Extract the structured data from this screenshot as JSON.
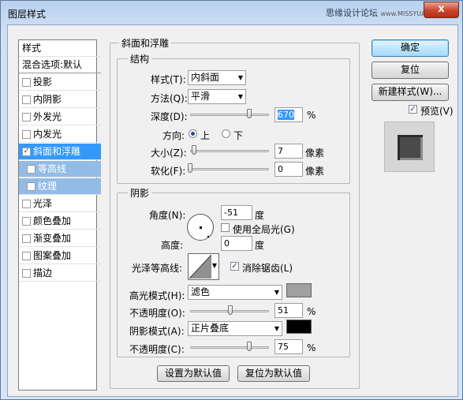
{
  "window": {
    "title": "图层样式",
    "watermark_main": "思缘设计论坛",
    "watermark_url": "www.MISSYUAN.com",
    "close_glyph": "x"
  },
  "styles_list": {
    "header": "样式",
    "blend_default": "混合选项:默认",
    "items": [
      {
        "label": "投影",
        "checked": false
      },
      {
        "label": "内阴影",
        "checked": false
      },
      {
        "label": "外发光",
        "checked": false
      },
      {
        "label": "内发光",
        "checked": false
      },
      {
        "label": "斜面和浮雕",
        "checked": true
      },
      {
        "label": "等高线",
        "checked": false
      },
      {
        "label": "纹理",
        "checked": false
      },
      {
        "label": "光泽",
        "checked": false
      },
      {
        "label": "颜色叠加",
        "checked": false
      },
      {
        "label": "渐变叠加",
        "checked": false
      },
      {
        "label": "图案叠加",
        "checked": false
      },
      {
        "label": "描边",
        "checked": false
      }
    ]
  },
  "bevel": {
    "section_title": "斜面和浮雕",
    "structure_title": "结构",
    "style_label": "样式(T):",
    "style_value": "内斜面",
    "technique_label": "方法(Q):",
    "technique_value": "平滑",
    "depth_label": "深度(D):",
    "depth_value": "670",
    "depth_unit": "%",
    "depth_slider": 0.75,
    "direction_label": "方向:",
    "direction_up": "上",
    "direction_down": "下",
    "size_label": "大小(Z):",
    "size_value": "7",
    "size_unit": "像素",
    "size_slider": 0.05,
    "soften_label": "软化(F):",
    "soften_value": "0",
    "soften_unit": "像素",
    "soften_slider": 0.0
  },
  "shading": {
    "title": "阴影",
    "angle_label": "角度(N):",
    "angle_value": "-51",
    "angle_unit": "度",
    "global_light_label": "使用全局光(G)",
    "altitude_label": "高度:",
    "altitude_value": "0",
    "altitude_unit": "度",
    "gloss_label": "光泽等高线:",
    "antialias_label": "消除锯齿(L)",
    "highlight_mode_label": "高光模式(H):",
    "highlight_mode_value": "滤色",
    "highlight_color": "#a0a0a0",
    "highlight_opacity_label": "不透明度(O):",
    "highlight_opacity_value": "51",
    "highlight_opacity_slider": 0.51,
    "shadow_mode_label": "阴影模式(A):",
    "shadow_mode_value": "正片叠底",
    "shadow_color": "#000000",
    "shadow_opacity_label": "不透明度(C):",
    "shadow_opacity_value": "75",
    "shadow_opacity_slider": 0.75,
    "percent": "%"
  },
  "footer": {
    "make_default": "设置为默认值",
    "reset_default": "复位为默认值"
  },
  "side_buttons": {
    "ok": "确定",
    "reset": "复位",
    "new_style": "新建样式(W)...",
    "preview": "预览(V)"
  }
}
